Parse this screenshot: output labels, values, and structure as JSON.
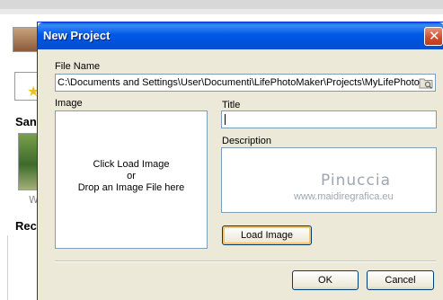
{
  "background": {
    "section_label_1": "San",
    "thumb_caption": "W",
    "section_label_2": "Rec"
  },
  "dialog": {
    "title": "New Project",
    "close_glyph": "✕",
    "file_name_label": "File Name",
    "file_name_value": "C:\\Documents and Settings\\User\\Documenti\\LifePhotoMaker\\Projects\\MyLifePhoto",
    "image_label": "Image",
    "image_hint_line1": "Click Load Image",
    "image_hint_line2": "or",
    "image_hint_line3": "Drop an Image File here",
    "title_label": "Title",
    "title_value": "",
    "description_label": "Description",
    "watermark_name": "Pinuccia",
    "watermark_site": "www.maidiregrafica.eu",
    "load_image_button": "Load Image",
    "ok_button": "OK",
    "cancel_button": "Cancel"
  },
  "colors": {
    "titlebar": "#0058e6",
    "dialog_bg": "#ece9d8",
    "field_border": "#7f9db9",
    "close_button": "#d14a2b",
    "focus_ring": "#f7c36b"
  },
  "icons": {
    "browse": "browse-folder-icon",
    "close": "close-icon"
  }
}
